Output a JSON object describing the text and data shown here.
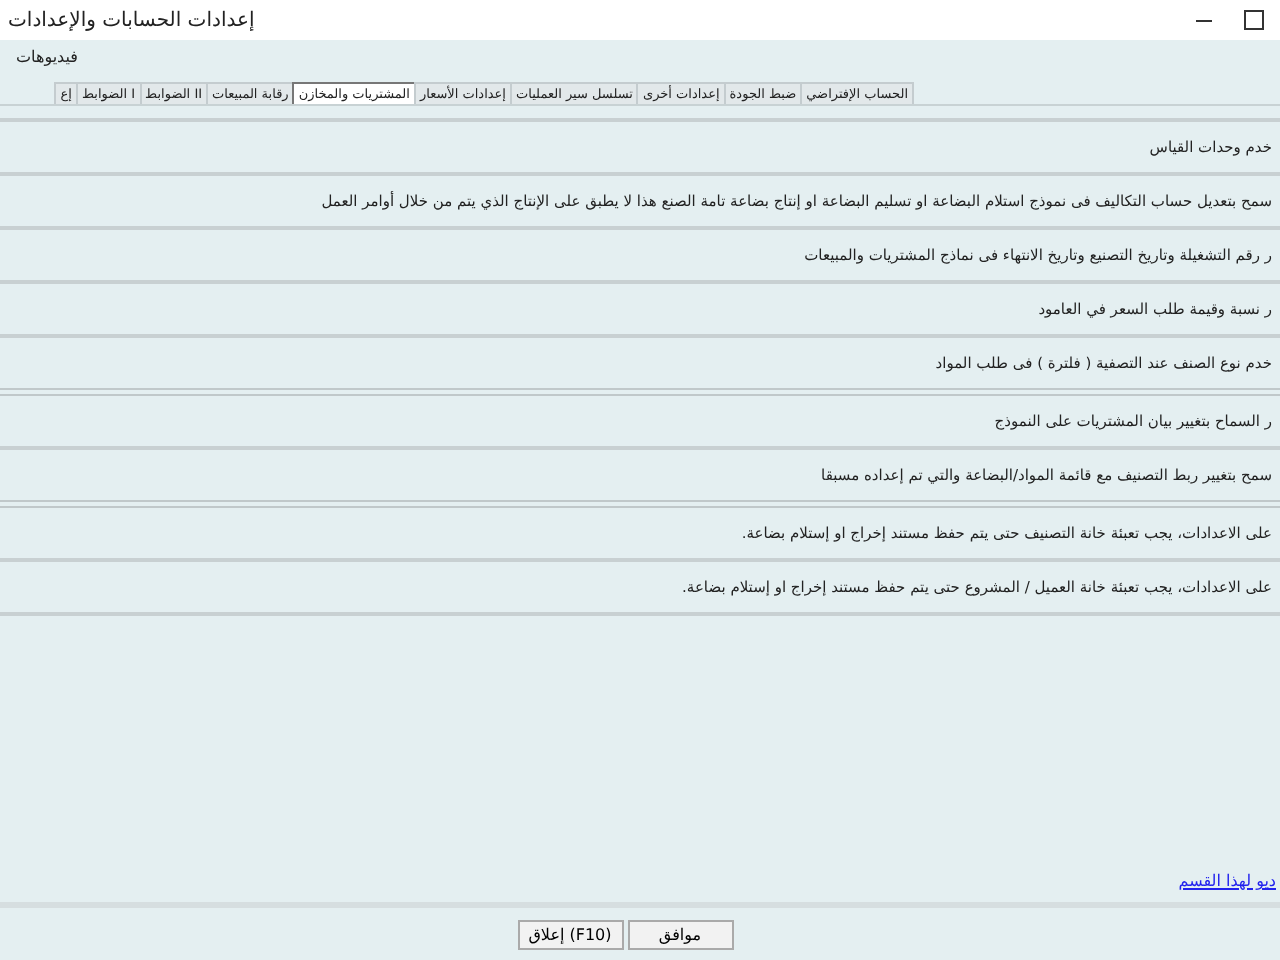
{
  "window": {
    "title": "إعدادات الحسابات والإعدادات"
  },
  "menu": {
    "label": "فيديوهات"
  },
  "tabs": [
    {
      "label": "الحساب الإفتراضي",
      "selected": false
    },
    {
      "label": "ضبط الجودة",
      "selected": false
    },
    {
      "label": "إعدادات أخرى",
      "selected": false
    },
    {
      "label": "تسلسل سير العمليات",
      "selected": false
    },
    {
      "label": "إعدادات الأسعار",
      "selected": false
    },
    {
      "label": "المشتريات والمخازن",
      "selected": true
    },
    {
      "label": "رقابة المبيعات",
      "selected": false
    },
    {
      "label": "الضوابط II",
      "selected": false
    },
    {
      "label": "الضوابط I",
      "selected": false
    },
    {
      "label": "إع",
      "selected": false
    }
  ],
  "settings": [
    {
      "text": "خدم وحدات القياس",
      "group_end": false
    },
    {
      "text": "سمح بتعديل حساب التكاليف فى نموذج استلام البضاعة او تسليم البضاعة او إنتاج بضاعة تامة الصنع هذا لا يطبق على الإنتاج الذي يتم من خلال أوامر العمل",
      "group_end": false
    },
    {
      "text": "ر رقم التشغيلة وتاريخ التصنيع وتاريخ الانتهاء فى نماذج المشتريات والمبيعات",
      "group_end": false
    },
    {
      "text": "ر نسبة وقيمة طلب السعر في العامود",
      "group_end": false
    },
    {
      "text": "خدم نوع الصنف عند التصفية ( فلترة ) فى طلب المواد",
      "group_end": true
    },
    {
      "text": "ر السماح بتغيير بيان المشتريات على النموذج",
      "group_end": false
    },
    {
      "text": "سمح بتغيير ربط التصنيف مع قائمة المواد/البضاعة والتي تم إعداده مسبقا",
      "group_end": true
    },
    {
      "text": "على الاعدادات، يجب تعبئة خانة التصنيف حتى يتم حفظ مستند إخراج او إستلام بضاعة.",
      "group_end": false
    },
    {
      "text": "على الاعدادات، يجب تعبئة خانة العميل / المشروع حتى يتم حفظ مستند إخراج او إستلام بضاعة.",
      "group_end": false
    }
  ],
  "video_link": "ديو لهذا القسم",
  "buttons": [
    "موافق",
    "إعلاق (F10)"
  ]
}
